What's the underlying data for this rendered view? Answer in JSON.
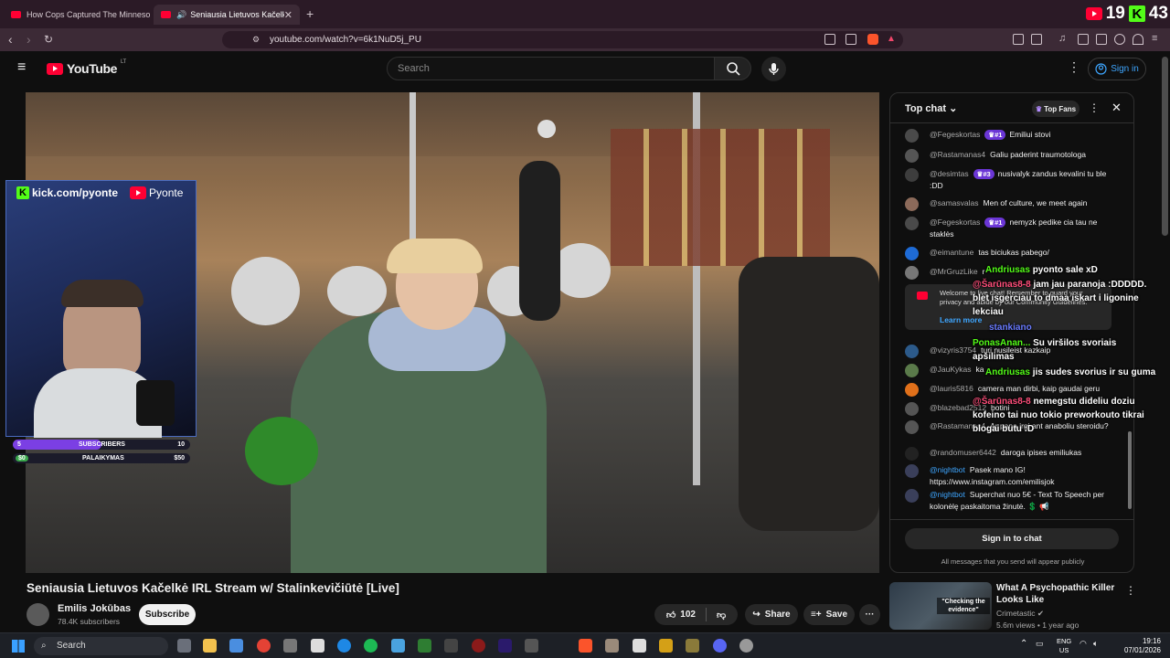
{
  "tabs": [
    {
      "label": "How Cops Captured The Minnesota"
    },
    {
      "label": "Seniausia Lietuvos Kačelkė IRL"
    }
  ],
  "overlay_counts": {
    "youtube": "19",
    "kick": "43"
  },
  "address": {
    "url": "youtube.com/watch?v=6k1NuD5j_PU"
  },
  "header": {
    "logo_text": "YouTube",
    "region": "LT",
    "search_placeholder": "Search",
    "signin_label": "Sign in"
  },
  "stream_overlay": {
    "kick_url": "kick.com/pyonte",
    "yt_name": "Pyonte",
    "subs_bar": {
      "left": "5",
      "label": "SUBSCRIBERS",
      "right": "10",
      "progress": 0.5
    },
    "support_bar": {
      "left": "$0",
      "label": "PALAIKYMAS",
      "right": "$50",
      "progress": 0.0
    }
  },
  "video": {
    "title": "Seniausia Lietuvos Kačelkė IRL Stream w/ Stalinkevičiūtė [Live]",
    "channel": "Emilis Jokūbas",
    "subscribers": "78.4K subscribers",
    "subscribe_label": "Subscribe",
    "likes": "102",
    "share_label": "Share",
    "save_label": "Save"
  },
  "chat": {
    "header": "Top chat",
    "top_fans_label": "Top Fans",
    "messages": [
      {
        "author": "@Fegeskortas",
        "badge": "#1",
        "text": "Emiliui stovi"
      },
      {
        "author": "@Rastamanas4",
        "badge": "",
        "text": "Galiu paderint traumotologa"
      },
      {
        "author": "@desimtas",
        "badge": "#3",
        "text": "nusivalyk zandus kevalini tu ble :DD"
      },
      {
        "author": "@samasvalas",
        "badge": "",
        "text": "Men of culture, we meet again"
      },
      {
        "author": "@Fegeskortas",
        "badge": "#1",
        "text": "nemyzk pedike cia tau ne staklės"
      },
      {
        "author": "@eimantune",
        "badge": "",
        "text": "tas biciukas pabego/"
      },
      {
        "author": "@MrGruzLike",
        "badge": "",
        "text": "r"
      },
      {
        "author": "@vizyris3754",
        "badge": "",
        "text": "turi nusileist kazkaip"
      },
      {
        "author": "@JauKykas",
        "badge": "",
        "text": "ka"
      },
      {
        "author": "@lauris5816",
        "badge": "",
        "text": "camera man dirbi, kaip gaudai geru"
      },
      {
        "author": "@blazebad2512",
        "badge": "",
        "text": "botini"
      },
      {
        "author": "@Rastamanas4",
        "badge": "",
        "text": "Ar pana irgi ant anaboliu steroidu?"
      },
      {
        "author": "@randomuser6442",
        "badge": "",
        "text": "daroga ipises emiliukas"
      },
      {
        "author": "@nightbot",
        "badge": "",
        "text": "Pasek mano IG! https://www.instagram.com/emilisjok"
      },
      {
        "author": "@nightbot",
        "badge": "",
        "text": "Superchat nuo 5€ - Text To Speech per kolonėlę paskaitoma žinutė. 💲 📢"
      }
    ],
    "welcome_text": "Welcome to live chat! Remember to guard your privacy and abide by our Community Guidelines.",
    "learn_more": "Learn more",
    "signin_chat": "Sign in to chat",
    "public_note": "All messages that you send will appear publicly"
  },
  "stream_chat_overlay": [
    {
      "user": "Andriusas",
      "platform": "kick",
      "text": "pyonto sale xD"
    },
    {
      "user": "@Šarūnas8-8",
      "platform": "youtube",
      "text": "jam jau paranoja :DDDDD. blet isgerciau to dmaa iskart i ligonine lekciau"
    },
    {
      "user": "stankiano",
      "platform": "kick",
      "text": ""
    },
    {
      "user": "PonasAnan...",
      "platform": "kick",
      "text": "Su viršilos svoriais apšilimas"
    },
    {
      "user": "Andriusas",
      "platform": "kick",
      "text": "jis sudes svorius ir su guma"
    },
    {
      "user": "@Šarūnas8-8",
      "platform": "youtube",
      "text": "nemegstu dideliu doziu kofeino tai nuo tokio preworkouto tikrai blogai butu :D"
    }
  ],
  "recommended": {
    "title": "What A Psychopathic Killer Looks Like",
    "channel": "Crimetastic",
    "meta": "5.6m views • 1 year ago",
    "thumb_caption": "\"Checking the evidence\""
  },
  "taskbar": {
    "search_placeholder": "Search",
    "lang_top": "ENG",
    "lang_bottom": "US",
    "time": "19:16",
    "date": "07/01/2026"
  },
  "colors": {
    "yt_red": "#ff0033",
    "kick_green": "#53fc18",
    "link_blue": "#3ea6ff",
    "bg": "#0f0f0f"
  }
}
